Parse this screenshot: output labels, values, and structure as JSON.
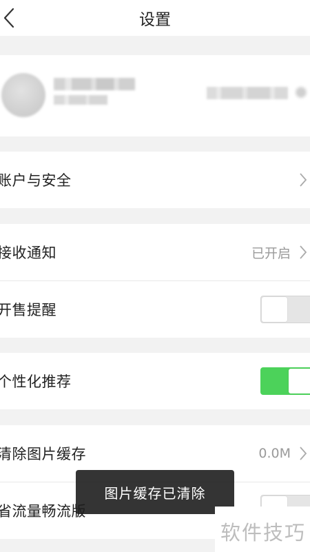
{
  "header": {
    "title": "设置",
    "back_icon": "chevron-left-icon"
  },
  "profile": {
    "avatar_icon": "avatar"
  },
  "settings": {
    "account": {
      "label": "账户与安全"
    },
    "notifications": {
      "label": "接收通知",
      "value": "已开启"
    },
    "sale_reminder": {
      "label": "开售提醒",
      "enabled": false
    },
    "personalized": {
      "label": "个性化推荐",
      "enabled": true
    },
    "clear_cache": {
      "label": "清除图片缓存",
      "value": "0.0M"
    },
    "data_saver": {
      "label": "省流量畅流版",
      "enabled": false
    }
  },
  "toast": {
    "message": "图片缓存已清除"
  },
  "watermark": {
    "text": "软件技巧"
  },
  "colors": {
    "toggle_on": "#4cd25a",
    "background": "#f2f2f2"
  }
}
